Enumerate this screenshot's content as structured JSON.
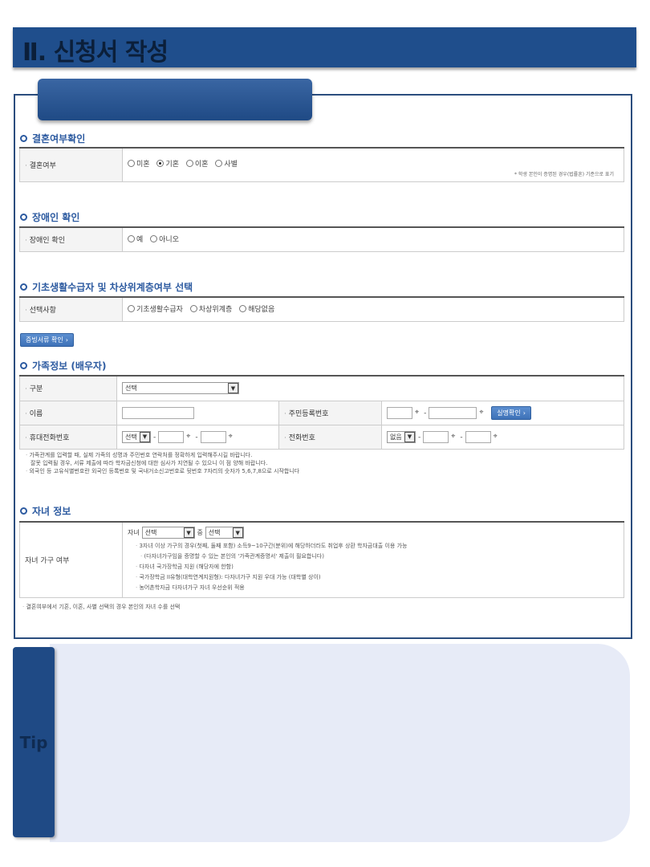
{
  "header": {
    "title": "Ⅱ. 신청서 작성"
  },
  "marriage": {
    "section_title": "결혼여부확인",
    "label": "결혼여부",
    "options": [
      "미혼",
      "기혼",
      "이혼",
      "사별"
    ],
    "selected": "기혼",
    "note": "* 학생 본인이 증명된 경우(법률혼) 기준으로 표기"
  },
  "disability": {
    "section_title": "장애인 확인",
    "label": "장애인 확인",
    "options": [
      "예",
      "아니오"
    ]
  },
  "basic_living": {
    "section_title": "기초생활수급자 및 차상위계층여부 선택",
    "label": "선택사항",
    "options": [
      "기초생활수급자",
      "차상위계층",
      "해당없음"
    ],
    "button": "증빙서류 확인"
  },
  "family": {
    "section_title": "가족정보 (배우자)",
    "type_label": "구분",
    "type_select": "선택",
    "name_label": "이름",
    "rrn_label": "주민등록번호",
    "verify_button": "실명확인",
    "mobile_label": "휴대전화번호",
    "mobile_select": "선택",
    "phone_label": "전화번호",
    "phone_select": "없음",
    "notes": [
      "가족관계를 입력할 때, 실제 가족의 성명과 주민번호 연락처를 정확하게 입력해주시길 바랍니다.",
      "잘못 입력될 경우, 서류 제출에 따라 학자금신청에 대한 심사가 지연될 수 있으니 이 점 양해 바랍니다.",
      "외국인 등 고유식별번호란 외국인 등록번호 및 국내거소신고번호로 뒷번호 7자리의 숫자가 5,6,7,8으로 시작합니다"
    ]
  },
  "children": {
    "section_title": "자녀 정보",
    "label": "자녀 가구 여부",
    "prefix": "자녀",
    "select1": "선택",
    "middle": "중",
    "select2": "선택",
    "lines": [
      "3자녀 이상 가구의 경우(첫째, 둘째 포함) 소득9~10구간(분위)에 해당하더라도 취업후 상환 학자금대출 이용 가능",
      "(다자녀가구임을 증명할 수 있는 본인의 '가족관계증명서' 제출이 필요합니다)",
      "다자녀 국가장학금 지원 (해당자에 한함)",
      "국가장학금 II유형(대학연계지원형): 다자녀가구 지원 우대 가능 (대학별 상이)",
      "농어촌학자금 다자녀가구 자녀 우선순위 적용"
    ],
    "note": "결혼여부에서 기혼, 이혼, 사별 선택의 경우 본인의 자녀 수를 선택"
  },
  "tip": {
    "label": "Tip"
  }
}
